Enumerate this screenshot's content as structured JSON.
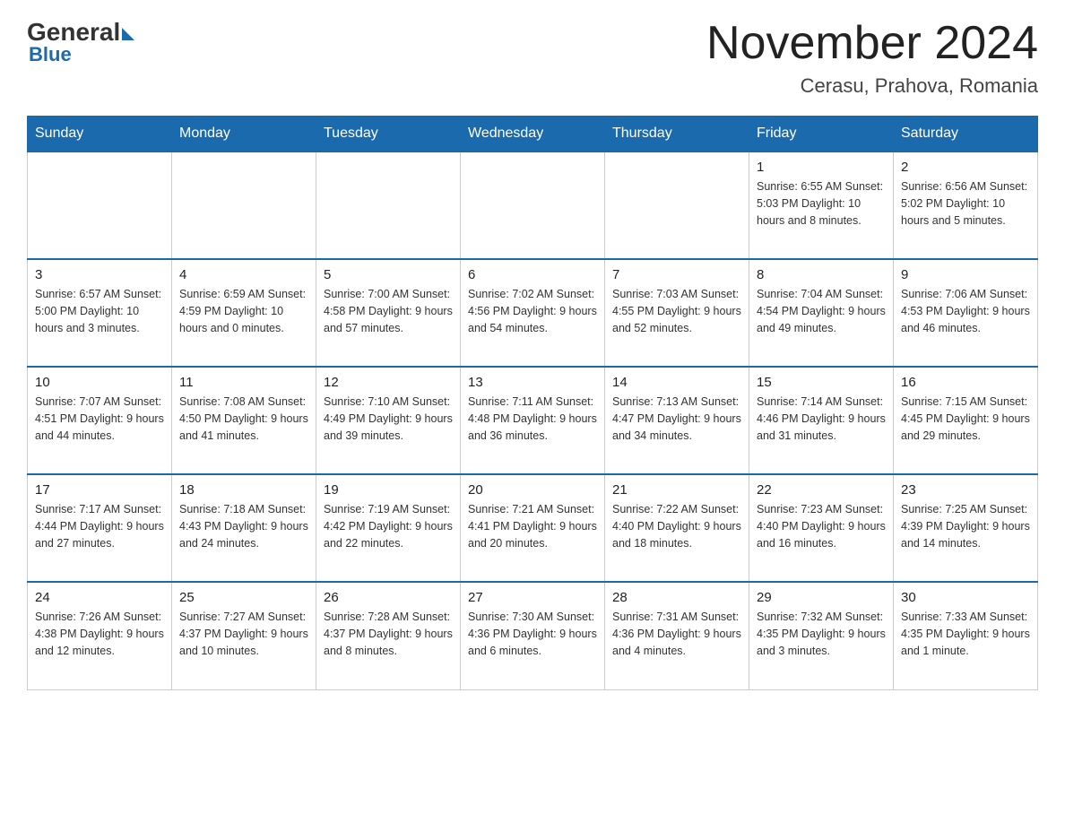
{
  "header": {
    "logo_general": "General",
    "logo_blue": "Blue",
    "calendar_title": "November 2024",
    "calendar_subtitle": "Cerasu, Prahova, Romania"
  },
  "weekdays": [
    "Sunday",
    "Monday",
    "Tuesday",
    "Wednesday",
    "Thursday",
    "Friday",
    "Saturday"
  ],
  "weeks": [
    [
      {
        "day": "",
        "info": ""
      },
      {
        "day": "",
        "info": ""
      },
      {
        "day": "",
        "info": ""
      },
      {
        "day": "",
        "info": ""
      },
      {
        "day": "",
        "info": ""
      },
      {
        "day": "1",
        "info": "Sunrise: 6:55 AM\nSunset: 5:03 PM\nDaylight: 10 hours\nand 8 minutes."
      },
      {
        "day": "2",
        "info": "Sunrise: 6:56 AM\nSunset: 5:02 PM\nDaylight: 10 hours\nand 5 minutes."
      }
    ],
    [
      {
        "day": "3",
        "info": "Sunrise: 6:57 AM\nSunset: 5:00 PM\nDaylight: 10 hours\nand 3 minutes."
      },
      {
        "day": "4",
        "info": "Sunrise: 6:59 AM\nSunset: 4:59 PM\nDaylight: 10 hours\nand 0 minutes."
      },
      {
        "day": "5",
        "info": "Sunrise: 7:00 AM\nSunset: 4:58 PM\nDaylight: 9 hours\nand 57 minutes."
      },
      {
        "day": "6",
        "info": "Sunrise: 7:02 AM\nSunset: 4:56 PM\nDaylight: 9 hours\nand 54 minutes."
      },
      {
        "day": "7",
        "info": "Sunrise: 7:03 AM\nSunset: 4:55 PM\nDaylight: 9 hours\nand 52 minutes."
      },
      {
        "day": "8",
        "info": "Sunrise: 7:04 AM\nSunset: 4:54 PM\nDaylight: 9 hours\nand 49 minutes."
      },
      {
        "day": "9",
        "info": "Sunrise: 7:06 AM\nSunset: 4:53 PM\nDaylight: 9 hours\nand 46 minutes."
      }
    ],
    [
      {
        "day": "10",
        "info": "Sunrise: 7:07 AM\nSunset: 4:51 PM\nDaylight: 9 hours\nand 44 minutes."
      },
      {
        "day": "11",
        "info": "Sunrise: 7:08 AM\nSunset: 4:50 PM\nDaylight: 9 hours\nand 41 minutes."
      },
      {
        "day": "12",
        "info": "Sunrise: 7:10 AM\nSunset: 4:49 PM\nDaylight: 9 hours\nand 39 minutes."
      },
      {
        "day": "13",
        "info": "Sunrise: 7:11 AM\nSunset: 4:48 PM\nDaylight: 9 hours\nand 36 minutes."
      },
      {
        "day": "14",
        "info": "Sunrise: 7:13 AM\nSunset: 4:47 PM\nDaylight: 9 hours\nand 34 minutes."
      },
      {
        "day": "15",
        "info": "Sunrise: 7:14 AM\nSunset: 4:46 PM\nDaylight: 9 hours\nand 31 minutes."
      },
      {
        "day": "16",
        "info": "Sunrise: 7:15 AM\nSunset: 4:45 PM\nDaylight: 9 hours\nand 29 minutes."
      }
    ],
    [
      {
        "day": "17",
        "info": "Sunrise: 7:17 AM\nSunset: 4:44 PM\nDaylight: 9 hours\nand 27 minutes."
      },
      {
        "day": "18",
        "info": "Sunrise: 7:18 AM\nSunset: 4:43 PM\nDaylight: 9 hours\nand 24 minutes."
      },
      {
        "day": "19",
        "info": "Sunrise: 7:19 AM\nSunset: 4:42 PM\nDaylight: 9 hours\nand 22 minutes."
      },
      {
        "day": "20",
        "info": "Sunrise: 7:21 AM\nSunset: 4:41 PM\nDaylight: 9 hours\nand 20 minutes."
      },
      {
        "day": "21",
        "info": "Sunrise: 7:22 AM\nSunset: 4:40 PM\nDaylight: 9 hours\nand 18 minutes."
      },
      {
        "day": "22",
        "info": "Sunrise: 7:23 AM\nSunset: 4:40 PM\nDaylight: 9 hours\nand 16 minutes."
      },
      {
        "day": "23",
        "info": "Sunrise: 7:25 AM\nSunset: 4:39 PM\nDaylight: 9 hours\nand 14 minutes."
      }
    ],
    [
      {
        "day": "24",
        "info": "Sunrise: 7:26 AM\nSunset: 4:38 PM\nDaylight: 9 hours\nand 12 minutes."
      },
      {
        "day": "25",
        "info": "Sunrise: 7:27 AM\nSunset: 4:37 PM\nDaylight: 9 hours\nand 10 minutes."
      },
      {
        "day": "26",
        "info": "Sunrise: 7:28 AM\nSunset: 4:37 PM\nDaylight: 9 hours\nand 8 minutes."
      },
      {
        "day": "27",
        "info": "Sunrise: 7:30 AM\nSunset: 4:36 PM\nDaylight: 9 hours\nand 6 minutes."
      },
      {
        "day": "28",
        "info": "Sunrise: 7:31 AM\nSunset: 4:36 PM\nDaylight: 9 hours\nand 4 minutes."
      },
      {
        "day": "29",
        "info": "Sunrise: 7:32 AM\nSunset: 4:35 PM\nDaylight: 9 hours\nand 3 minutes."
      },
      {
        "day": "30",
        "info": "Sunrise: 7:33 AM\nSunset: 4:35 PM\nDaylight: 9 hours\nand 1 minute."
      }
    ]
  ]
}
